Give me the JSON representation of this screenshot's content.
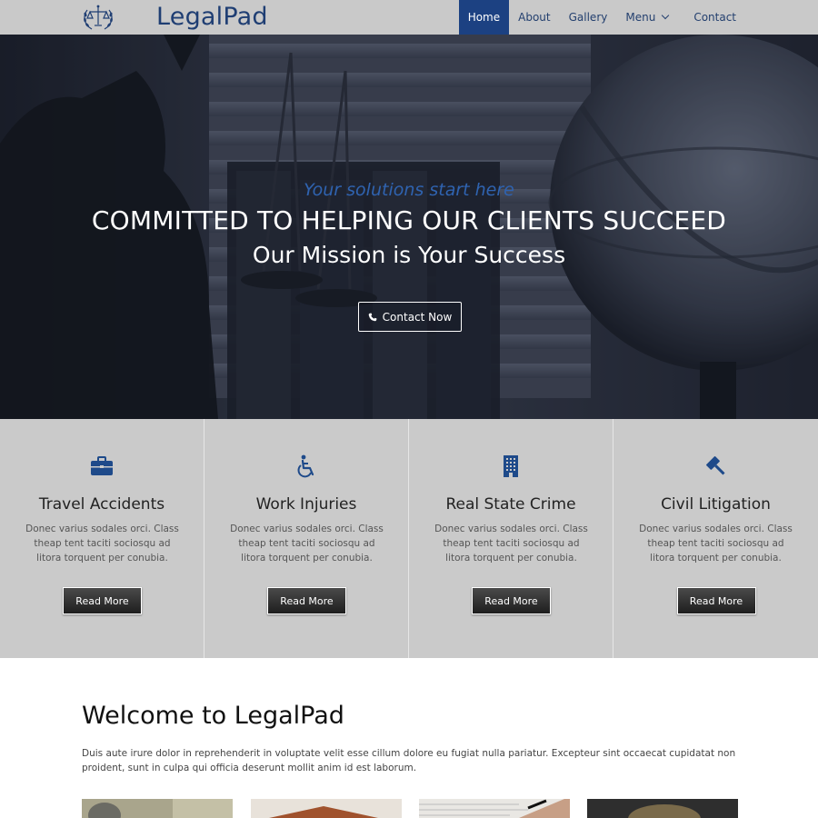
{
  "header": {
    "brand": "LegalPad",
    "logo_icon": "scales-laurel-icon",
    "nav": [
      {
        "label": "Home",
        "active": true
      },
      {
        "label": "About",
        "active": false
      },
      {
        "label": "Gallery",
        "active": false
      },
      {
        "label": "Menu",
        "active": false,
        "dropdown": true
      },
      {
        "label": "Contact",
        "active": false
      }
    ]
  },
  "hero": {
    "tagline": "Your solutions start here",
    "title": "COMMITTED TO HELPING OUR CLIENTS SUCCEED",
    "subtitle": "Our Mission is Your Success",
    "button_label": "Contact Now",
    "button_icon": "phone-icon"
  },
  "services": [
    {
      "icon": "briefcase-icon",
      "title": "Travel Accidents",
      "text": "Donec varius sodales orci. Class theap tent taciti sociosqu ad litora torquent per conubia.",
      "button": "Read More"
    },
    {
      "icon": "wheelchair-icon",
      "title": "Work Injuries",
      "text": "Donec varius sodales orci. Class theap tent taciti sociosqu ad litora torquent per conubia.",
      "button": "Read More"
    },
    {
      "icon": "building-icon",
      "title": "Real State Crime",
      "text": "Donec varius sodales orci. Class theap tent taciti sociosqu ad litora torquent per conubia.",
      "button": "Read More"
    },
    {
      "icon": "gavel-icon",
      "title": "Civil Litigation",
      "text": "Donec varius sodales orci. Class theap tent taciti sociosqu ad litora torquent per conubia.",
      "button": "Read More"
    }
  ],
  "welcome": {
    "title": "Welcome to LegalPad",
    "text": "Duis aute irure dolor in reprehenderit in voluptate velit esse cillum dolore eu fugiat nulla pariatur. Excepteur sint occaecat cupidatat non proident, sunt in culpa qui officia deserunt mollit anim id est laborum."
  },
  "colors": {
    "accent": "#1c4182",
    "brand_text": "#1f3e73",
    "header_bg": "#c9c9c9",
    "services_bg": "#cacaca",
    "icon_blue": "#1e4a8a"
  }
}
